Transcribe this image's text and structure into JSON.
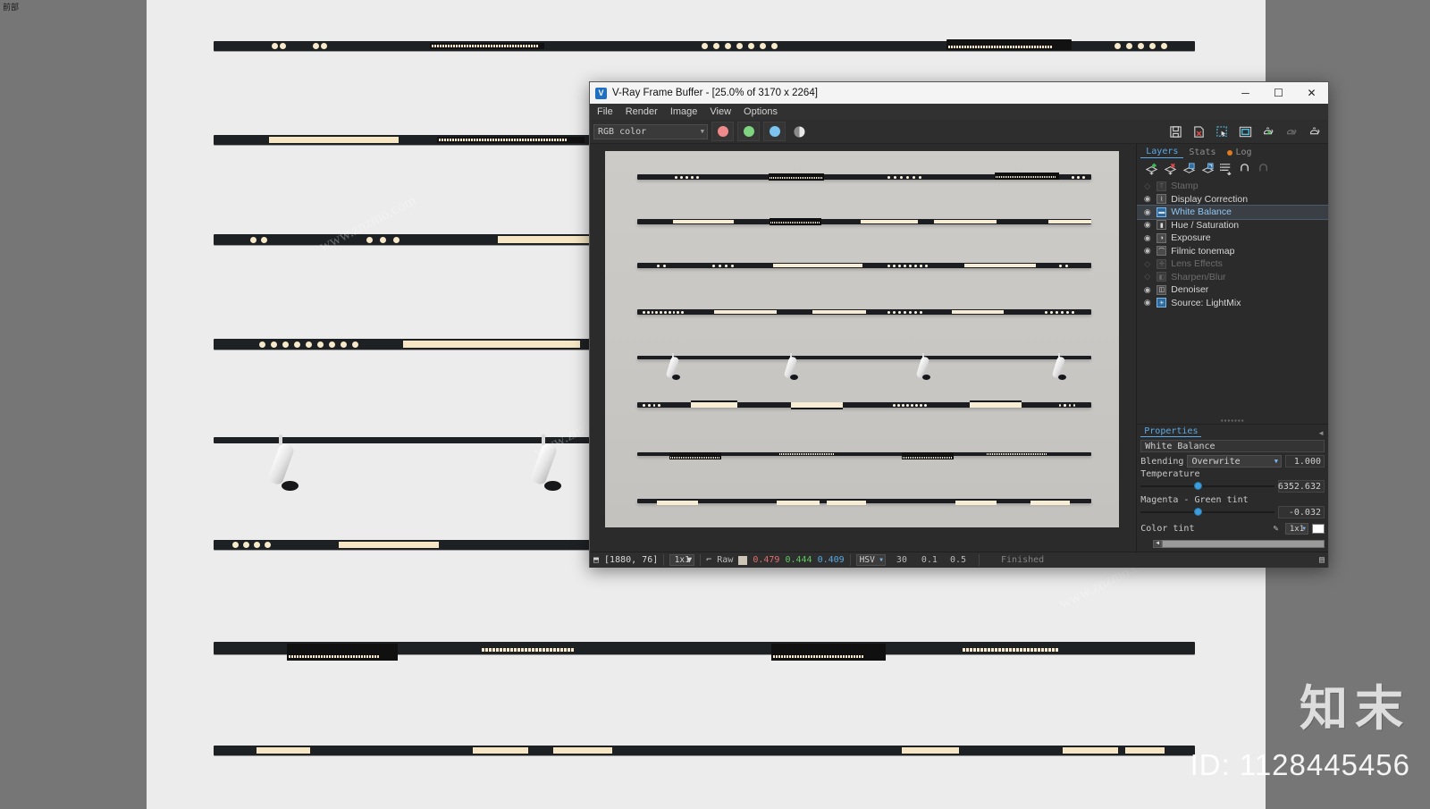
{
  "host": {
    "viewport_label": "前部",
    "background_color": "#767676",
    "panel_color": "#ececec"
  },
  "watermark": {
    "texts": [
      "www.znzmo.com",
      "www.znzmo.com",
      "www.znzmo.com",
      "www.znzmo.com",
      "www.znzmo.com",
      "www.znzmo.com"
    ],
    "logo": "知末",
    "id": "ID: 1128445456"
  },
  "window": {
    "title": "V-Ray Frame Buffer - [25.0% of 3170 x 2264]",
    "logo_icon": "vray-logo-icon",
    "controls": [
      {
        "name": "minimize-button",
        "glyph": "─"
      },
      {
        "name": "maximize-button",
        "glyph": "☐"
      },
      {
        "name": "close-button",
        "glyph": "✕"
      }
    ]
  },
  "menubar": {
    "items": [
      {
        "label": "File",
        "name": "menu-file"
      },
      {
        "label": "Render",
        "name": "menu-render"
      },
      {
        "label": "Image",
        "name": "menu-image"
      },
      {
        "label": "View",
        "name": "menu-view"
      },
      {
        "label": "Options",
        "name": "menu-options"
      }
    ]
  },
  "toolbar": {
    "channel_select": {
      "value": "RGB color",
      "placeholder": "RGB color"
    },
    "channel_buttons": [
      {
        "name": "red-channel-button",
        "color": "#f08a8a"
      },
      {
        "name": "green-channel-button",
        "color": "#7fd47f"
      },
      {
        "name": "blue-channel-button",
        "color": "#7cc4f0"
      },
      {
        "name": "monochrome-channel-button",
        "color": "#e8e8e8"
      }
    ],
    "right_icons": [
      {
        "name": "save-image-icon"
      },
      {
        "name": "save-image-as-icon"
      },
      {
        "name": "region-render-icon"
      },
      {
        "name": "show-last-vfb-icon"
      },
      {
        "name": "start-render-icon"
      },
      {
        "name": "stop-render-icon"
      },
      {
        "name": "render-last-icon"
      }
    ]
  },
  "tabs": [
    {
      "label": "Layers",
      "name": "tab-layers",
      "active": true
    },
    {
      "label": "Stats",
      "name": "tab-stats",
      "active": false
    },
    {
      "label": "Log",
      "name": "tab-log",
      "active": false,
      "badge": true
    }
  ],
  "layer_tools": [
    {
      "name": "add-layer-icon",
      "glyph": "+"
    },
    {
      "name": "remove-layer-icon",
      "glyph": "✕"
    },
    {
      "name": "duplicate-layer-icon",
      "glyph": "⧉"
    },
    {
      "name": "load-layer-preset-icon",
      "glyph": "⎘"
    },
    {
      "name": "layer-list-icon",
      "glyph": "≡"
    },
    {
      "name": "undo-icon",
      "glyph": "↶"
    },
    {
      "name": "redo-icon",
      "glyph": "↷"
    }
  ],
  "layers": [
    {
      "label": "Stamp",
      "icon": "stamp-icon",
      "visible": false,
      "enabled": false,
      "selected": false
    },
    {
      "label": "Display Correction",
      "icon": "curve-icon",
      "visible": true,
      "enabled": true,
      "selected": false
    },
    {
      "label": "White Balance",
      "icon": "white-balance-icon",
      "visible": true,
      "enabled": true,
      "selected": true
    },
    {
      "label": "Hue / Saturation",
      "icon": "hue-saturation-icon",
      "visible": true,
      "enabled": true,
      "selected": false
    },
    {
      "label": "Exposure",
      "icon": "exposure-icon",
      "visible": true,
      "enabled": true,
      "selected": false
    },
    {
      "label": "Filmic tonemap",
      "icon": "filmic-tonemap-icon",
      "visible": true,
      "enabled": true,
      "selected": false
    },
    {
      "label": "Lens Effects",
      "icon": "lens-effects-icon",
      "visible": false,
      "enabled": false,
      "selected": false
    },
    {
      "label": "Sharpen/Blur",
      "icon": "sharpen-blur-icon",
      "visible": false,
      "enabled": false,
      "selected": false
    },
    {
      "label": "Denoiser",
      "icon": "denoiser-icon",
      "visible": true,
      "enabled": true,
      "selected": false
    },
    {
      "label": "Source: LightMix",
      "icon": "lightmix-icon",
      "visible": true,
      "enabled": true,
      "selected": false
    }
  ],
  "properties": {
    "tab_label": "Properties",
    "collapse_icon": "collapse-icon",
    "layer_name": "White Balance",
    "blending_label": "Blending",
    "blending_value": "Overwrite",
    "blending_amount": "1.000",
    "temperature_label": "Temperature",
    "temperature_value": "6352.632",
    "temperature_knob_pct": 40,
    "tint_label": "Magenta - Green tint",
    "tint_value": "-0.032",
    "tint_knob_pct": 40,
    "color_tint_label": "Color tint",
    "color_tint_picker_icon": "eyedropper-icon",
    "color_tint_mode": "1x1",
    "color_tint_swatch": "#ffffff"
  },
  "statusbar": {
    "pixel_icon": "pixel-probe-icon",
    "coords": "[1880, 76]",
    "sample_size": "1x1",
    "curve_icon": "color-curve-icon",
    "raw_label": "Raw",
    "raw_swatch": "#cdc6b8",
    "rgb": {
      "r": "0.479",
      "g": "0.444",
      "b": "0.409"
    },
    "colorspace": "HSV",
    "hsv": [
      "30",
      "0.1",
      "0.5"
    ],
    "status": "Finished",
    "layers_toggle_icon": "toggle-panel-icon"
  },
  "render_preview": {
    "description": "Magnetic linear track lighting system render on grey backdrop",
    "background_color": "#c9c7c3",
    "rows": [
      {
        "type": "track",
        "fixtures": [
          "spot-dots",
          "grille-linear"
        ]
      },
      {
        "type": "track",
        "fixtures": [
          "linear-warm",
          "grille-linear",
          "linear-warm"
        ]
      },
      {
        "type": "track",
        "fixtures": [
          "spot-dots",
          "spot-dots",
          "linear-warm"
        ]
      },
      {
        "type": "track",
        "fixtures": [
          "dot-array",
          "linear-warm",
          "dot-array",
          "dot-array"
        ]
      },
      {
        "type": "track",
        "fixtures": [
          "cylinder-spot",
          "cylinder-spot",
          "cylinder-spot",
          "cylinder-spot"
        ]
      },
      {
        "type": "track",
        "fixtures": [
          "dot-array",
          "linear-warm",
          "linear-warm",
          "dot-array",
          "linear-warm",
          "dot-array"
        ]
      },
      {
        "type": "track",
        "fixtures": [
          "grille-linear",
          "dot-array",
          "grille-linear",
          "dot-array"
        ]
      },
      {
        "type": "track",
        "fixtures": [
          "linear-warm",
          "linear-warm",
          "linear-warm",
          "linear-warm"
        ]
      }
    ]
  }
}
